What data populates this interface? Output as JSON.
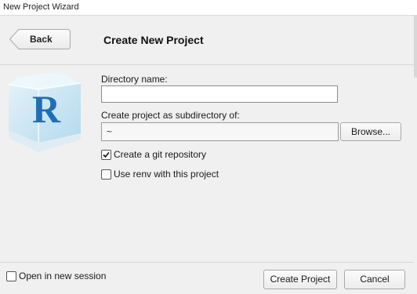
{
  "window": {
    "title": "New Project Wizard"
  },
  "header": {
    "back_label": "Back",
    "title": "Create New Project"
  },
  "form": {
    "directory_label": "Directory name:",
    "directory_value": "",
    "parent_label": "Create project as subdirectory of:",
    "parent_value": "~",
    "browse_label": "Browse...",
    "git_label": "Create a git repository",
    "git_checked": true,
    "renv_label": "Use renv with this project",
    "renv_checked": false
  },
  "footer": {
    "new_session_label": "Open in new session",
    "new_session_checked": false,
    "create_label": "Create Project",
    "cancel_label": "Cancel"
  },
  "colors": {
    "logo_blue": "#1f6fb5",
    "logo_cube": "#bfe1f3"
  }
}
